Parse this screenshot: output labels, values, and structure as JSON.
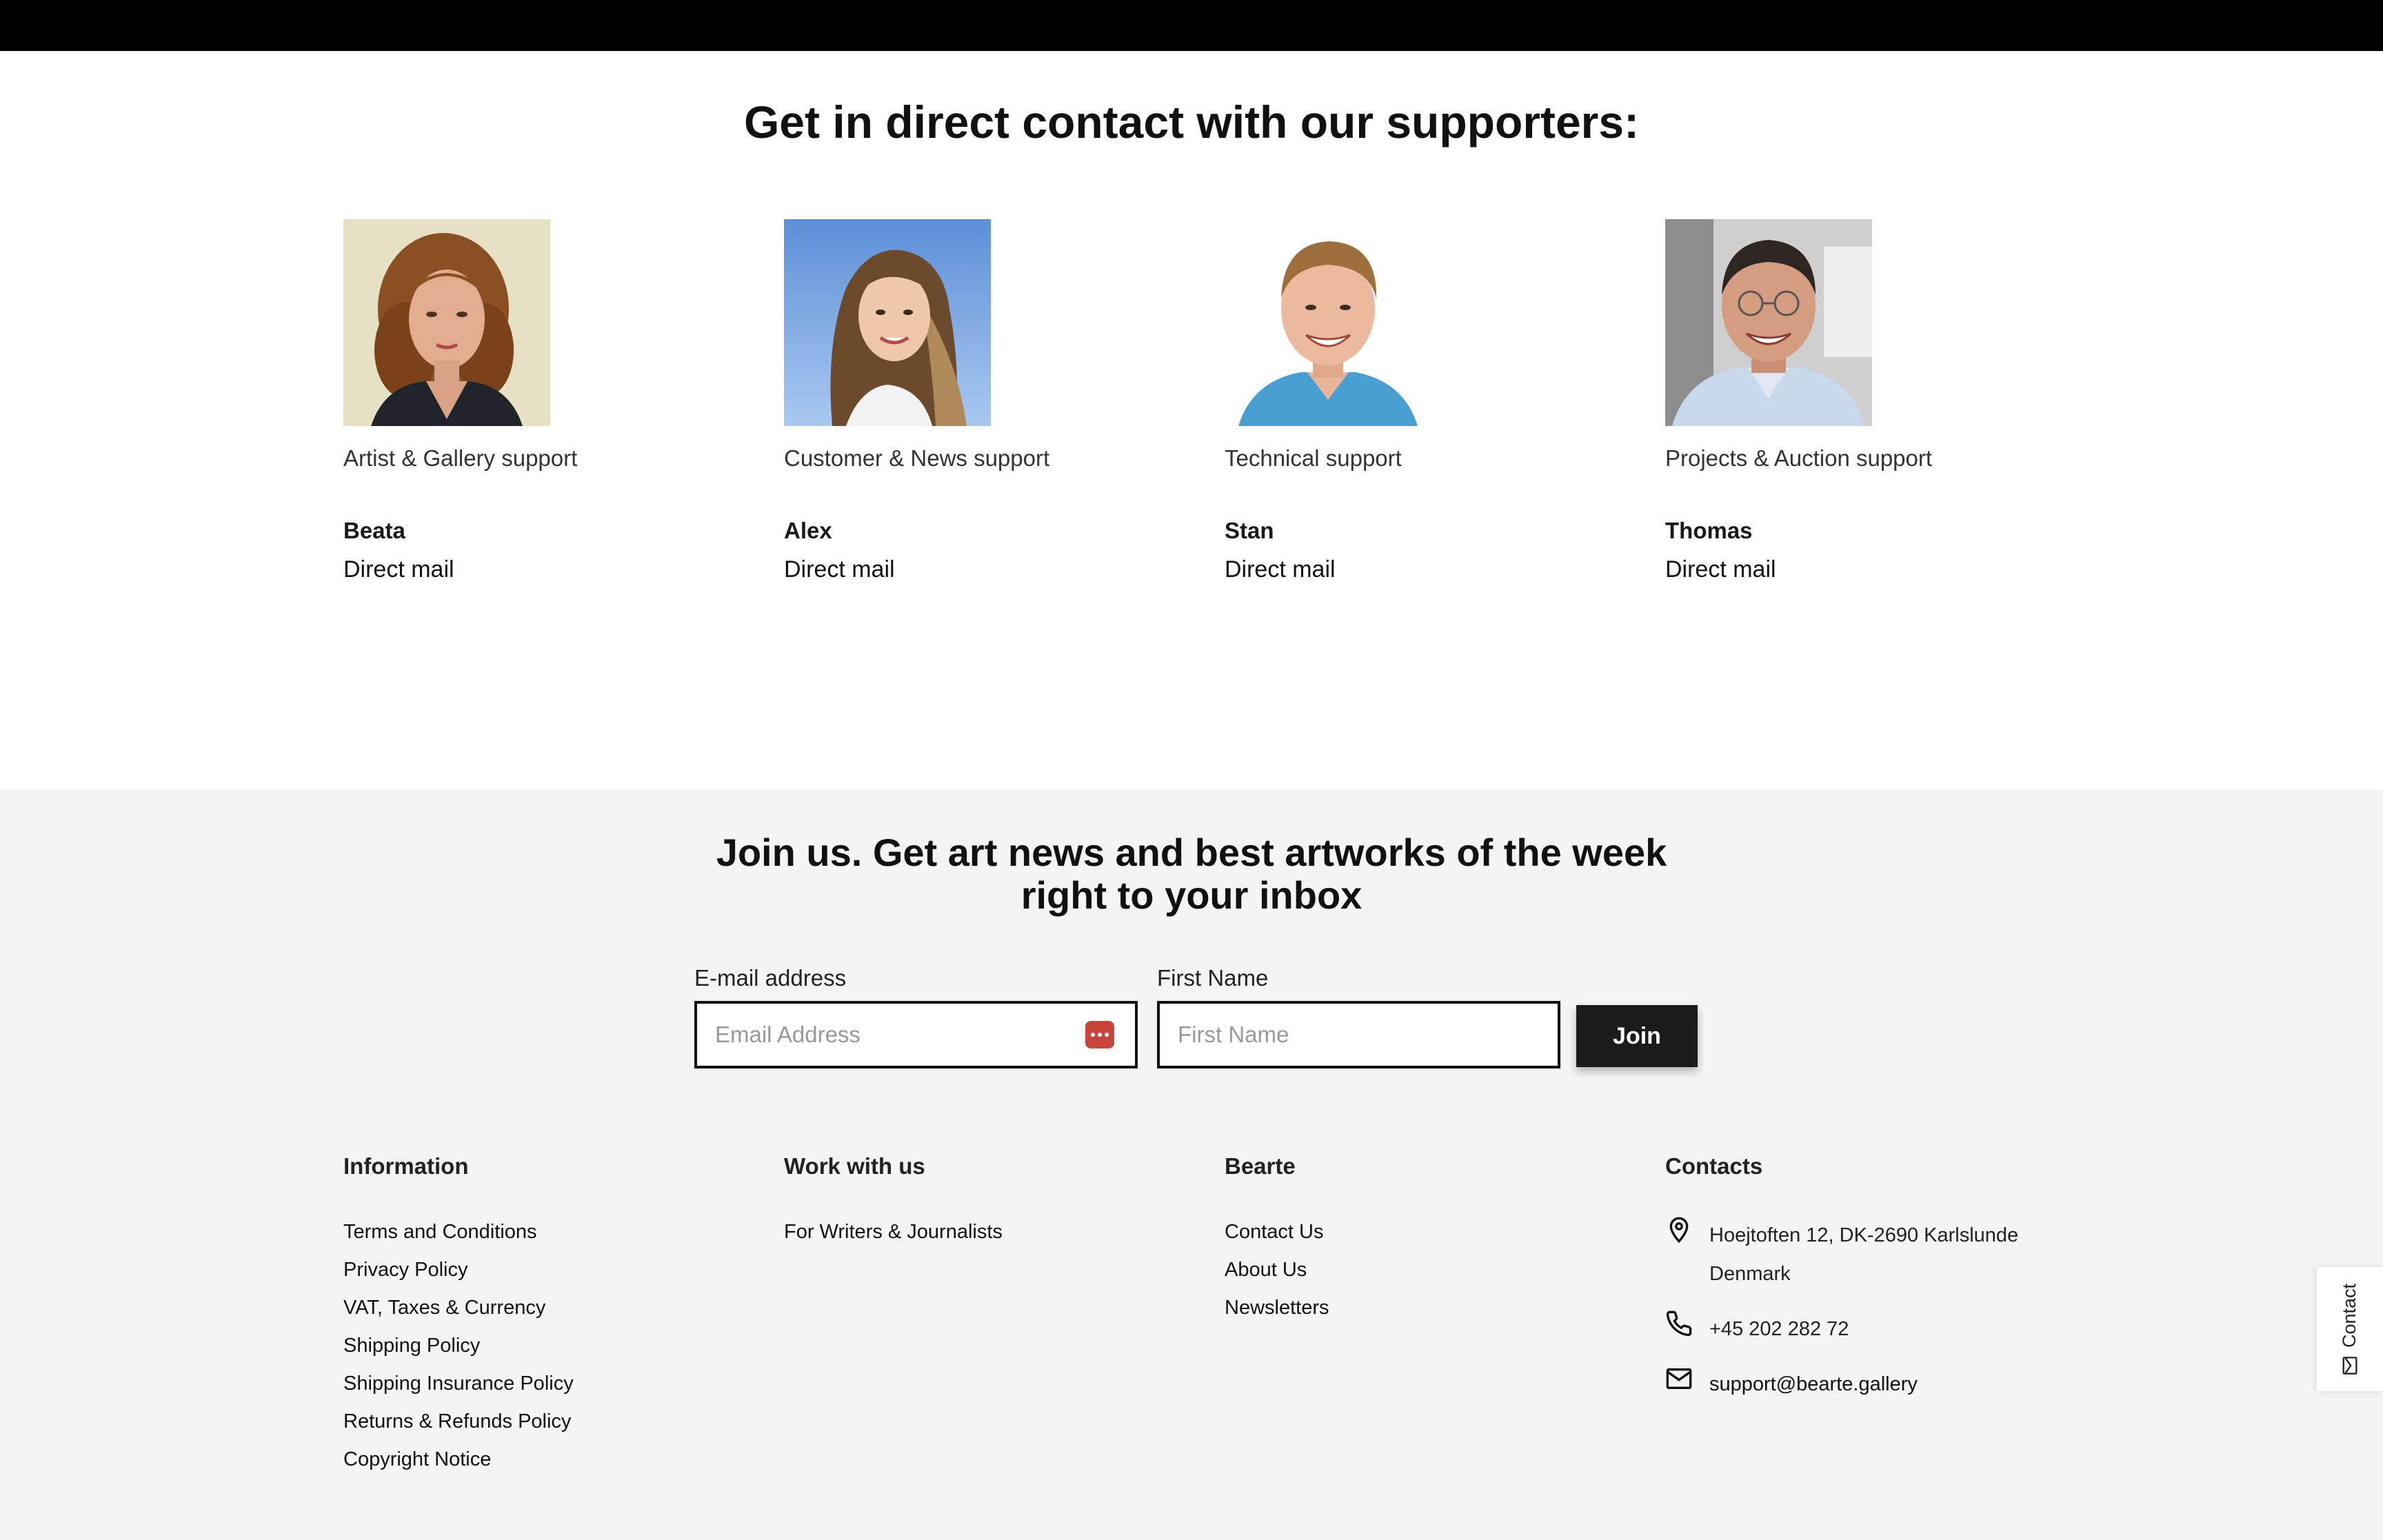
{
  "supporters": {
    "title": "Get in direct contact with our supporters:",
    "people": [
      {
        "role": "Artist & Gallery support",
        "name": "Beata",
        "link": "Direct mail"
      },
      {
        "role": "Customer & News support",
        "name": "Alex",
        "link": "Direct mail"
      },
      {
        "role": "Technical support",
        "name": "Stan",
        "link": "Direct mail"
      },
      {
        "role": "Projects & Auction support",
        "name": "Thomas",
        "link": "Direct mail"
      }
    ]
  },
  "newsletter": {
    "title_line1": "Join us. Get art news and best artworks of the week",
    "title_line2": "right to your inbox",
    "email_label": "E-mail address",
    "email_placeholder": "Email Address",
    "firstname_label": "First Name",
    "firstname_placeholder": "First Name",
    "join_label": "Join"
  },
  "footer": {
    "information": {
      "heading": "Information",
      "links": [
        "Terms and Conditions",
        "Privacy Policy",
        "VAT, Taxes & Currency",
        "Shipping Policy",
        "Shipping Insurance Policy",
        "Returns & Refunds Policy",
        "Copyright Notice"
      ]
    },
    "work": {
      "heading": "Work with us",
      "links": [
        "For Writers & Journalists"
      ]
    },
    "bearte": {
      "heading": "Bearte",
      "links": [
        "Contact Us",
        "About Us",
        "Newsletters"
      ]
    },
    "contacts": {
      "heading": "Contacts",
      "address_line1": "Hoejtoften 12, DK-2690 Karlslunde",
      "address_line2": "Denmark",
      "phone": "+45 202 282 72",
      "email": "support@bearte.gallery"
    }
  },
  "contact_tab": {
    "label": "Contact"
  },
  "icons": {
    "address": "map-pin-icon",
    "phone": "phone-icon",
    "email": "envelope-icon",
    "password_manager": "password-manager-icon"
  },
  "colors": {
    "topbar": "#000000",
    "footer_bg": "#f4f4f4",
    "join_button": "#1b1b1b",
    "password_icon": "#c9453b"
  }
}
